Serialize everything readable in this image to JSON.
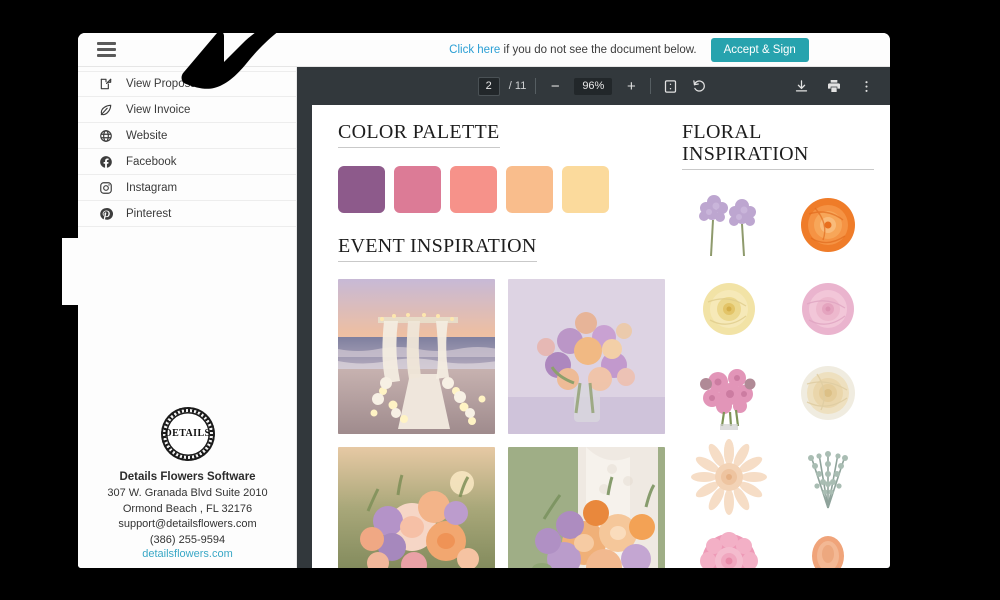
{
  "window": {
    "topbar": {
      "menu_icon": "hamburger-icon",
      "notice_link": "Click here",
      "notice_text": " if you do not see the document below.",
      "accept_button": "Accept & Sign"
    }
  },
  "sidebar": {
    "items": [
      {
        "label": "View Proposal",
        "icon": "proposal-icon"
      },
      {
        "label": "View Invoice",
        "icon": "invoice-icon"
      },
      {
        "label": "Website",
        "icon": "globe-icon"
      },
      {
        "label": "Facebook",
        "icon": "facebook-icon"
      },
      {
        "label": "Instagram",
        "icon": "instagram-icon"
      },
      {
        "label": "Pinterest",
        "icon": "pinterest-icon"
      }
    ],
    "brand": {
      "logo_text": "DETAILS",
      "logo_sub": "WWW.DETAILSFLOWERS.COM",
      "name": "Details Flowers Software",
      "address1": "307 W. Granada Blvd Suite 2010",
      "address2": "Ormond Beach , FL 32176",
      "email": "support@detailsflowers.com",
      "phone": "(386) 255-9594",
      "website": "detailsflowers.com",
      "link_color": "#3aa8c6"
    }
  },
  "viewer": {
    "toolbar": {
      "current_page": "2",
      "page_total": "/ 11",
      "zoom_out": "−",
      "zoom_level": "96%",
      "zoom_in": "+",
      "fit_icon": "fit-page-icon",
      "rotate_icon": "rotate-icon",
      "download_icon": "download-icon",
      "print_icon": "print-icon",
      "more_icon": "more-options-icon"
    },
    "document": {
      "color_palette": {
        "heading": "COLOR PALETTE",
        "swatches": [
          {
            "name": "plum",
            "hex": "#8d5a8b"
          },
          {
            "name": "rose",
            "hex": "#dc7b96"
          },
          {
            "name": "salmon",
            "hex": "#f6928a"
          },
          {
            "name": "peach",
            "hex": "#f9bd8c"
          },
          {
            "name": "butter",
            "hex": "#fbda9c"
          }
        ]
      },
      "event_inspiration": {
        "heading": "EVENT INSPIRATION",
        "images": [
          {
            "alt": "beach-ceremony-arch-at-sunset"
          },
          {
            "alt": "pastel-floral-arrangement-in-vase"
          },
          {
            "alt": "peach-and-lavender-bouquet-in-field"
          },
          {
            "alt": "bride-holding-orange-lavender-bouquet"
          }
        ]
      },
      "floral_inspiration": {
        "heading": "FLORAL INSPIRATION",
        "flowers": [
          {
            "alt": "lilac-stems"
          },
          {
            "alt": "orange-rose"
          },
          {
            "alt": "yellow-rose"
          },
          {
            "alt": "pink-rose"
          },
          {
            "alt": "pink-chrysanthemums"
          },
          {
            "alt": "cream-garden-rose"
          },
          {
            "alt": "peach-dahlia"
          },
          {
            "alt": "dusty-miller-sprig"
          },
          {
            "alt": "pink-peony"
          },
          {
            "alt": "peach-rose-bud"
          }
        ]
      }
    }
  },
  "annotation": {
    "arrow": "down-left-pointer-arrow"
  }
}
